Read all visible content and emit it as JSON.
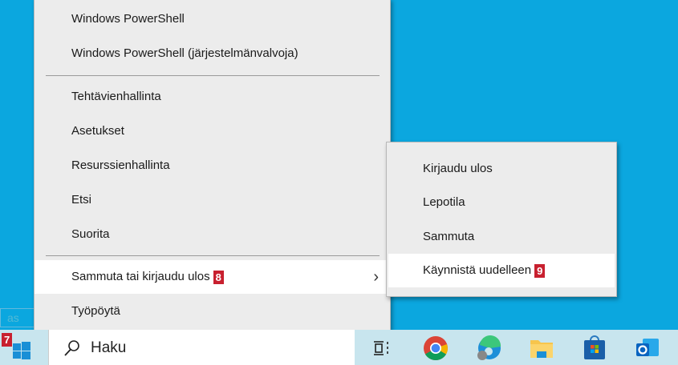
{
  "menu": {
    "items": [
      {
        "label": "Windows PowerShell"
      },
      {
        "label": "Windows PowerShell (järjestelmänvalvoja)"
      },
      {
        "label": "Tehtävienhallinta"
      },
      {
        "label": "Asetukset"
      },
      {
        "label": "Resurssienhallinta"
      },
      {
        "label": "Etsi"
      },
      {
        "label": "Suorita"
      },
      {
        "label": "Sammuta tai kirjaudu ulos",
        "badge": "8"
      },
      {
        "label": "Työpöytä"
      }
    ]
  },
  "submenu": {
    "items": [
      {
        "label": "Kirjaudu ulos"
      },
      {
        "label": "Lepotila"
      },
      {
        "label": "Sammuta"
      },
      {
        "label": "Käynnistä uudelleen",
        "badge": "9"
      }
    ]
  },
  "taskbar": {
    "start_badge": "7",
    "search_placeholder": "Haku",
    "tooltip": "as"
  },
  "colors": {
    "desktop": "#0ba7df",
    "badge": "#c8202f"
  }
}
